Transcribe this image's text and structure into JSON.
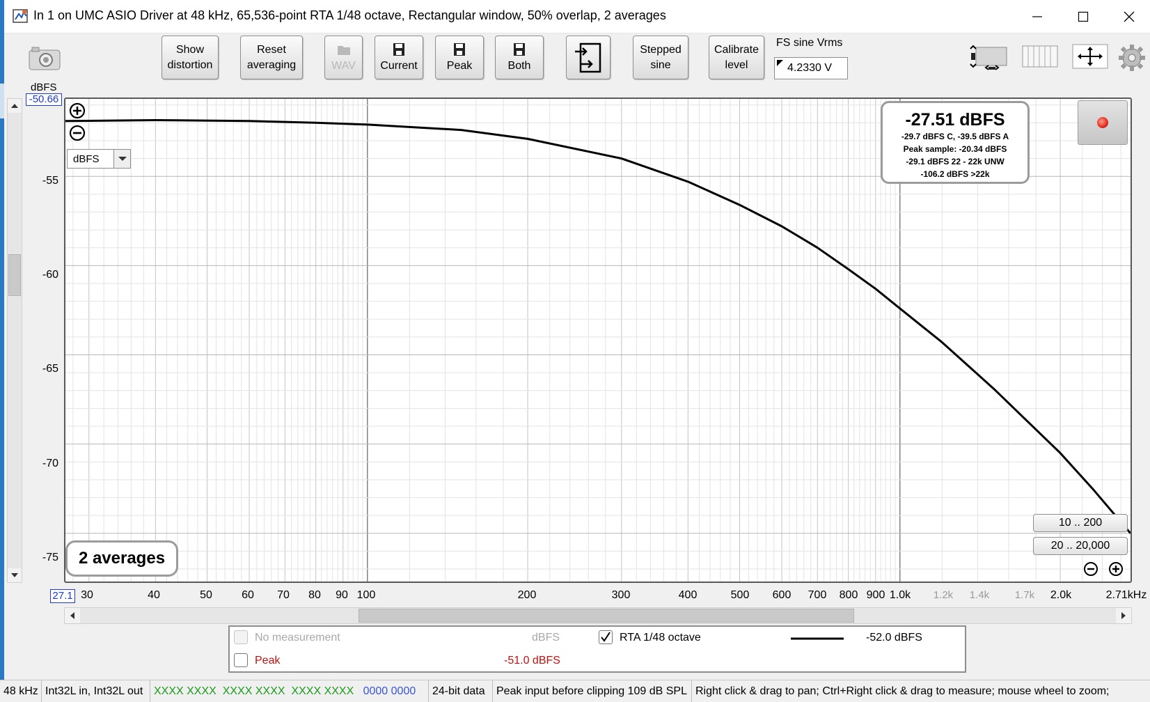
{
  "window": {
    "title": "In 1 on UMC ASIO Driver at 48 kHz, 65,536-point RTA 1/48 octave, Rectangular window, 50% overlap, 2 averages"
  },
  "toolbar": {
    "show_distortion_l1": "Show",
    "show_distortion_l2": "distortion",
    "reset_averaging_l1": "Reset",
    "reset_averaging_l2": "averaging",
    "wav_label": "WAV",
    "current_label": "Current",
    "peak_label": "Peak",
    "both_label": "Both",
    "stepped_sine_l1": "Stepped",
    "stepped_sine_l2": "sine",
    "calibrate_l1": "Calibrate",
    "calibrate_l2": "level",
    "fs_label": "FS sine Vrms",
    "fs_value": "4.2330 V"
  },
  "y_axis": {
    "unit": "dBFS",
    "top_value": "-50.66",
    "ticks": [
      "-55",
      "-60",
      "-65",
      "-70",
      "-75"
    ]
  },
  "x_axis": {
    "left_value": "27.1",
    "ticks": [
      "30",
      "40",
      "50",
      "60",
      "70",
      "80",
      "90",
      "100",
      "200",
      "300",
      "400",
      "500",
      "600",
      "700",
      "800",
      "900",
      "1.0k",
      "2.0k",
      "2.71kHz"
    ],
    "minor_ticks": [
      "1.2k",
      "1.4k",
      "1.7k"
    ]
  },
  "plot": {
    "unit_select": "dBFS",
    "level_main": "-27.51 dBFS",
    "level_line1": "-29.7 dBFS C, -39.5 dBFS A",
    "level_line2": "Peak sample: -20.34 dBFS",
    "level_line3": "-29.1 dBFS 22 - 22k UNW",
    "level_line4": "-106.2 dBFS >22k",
    "averages": "2 averages",
    "range_a": "10 .. 200",
    "range_b": "20 .. 20,000"
  },
  "legend": {
    "row1_label": "No measurement",
    "row1_unit": "dBFS",
    "row2_label": "Peak",
    "row2_value": "-51.0 dBFS",
    "rta_label": "RTA 1/48 octave",
    "rta_value": "-52.0 dBFS",
    "rta_checked": true
  },
  "status": {
    "rate": "48 kHz",
    "io": "Int32L in, Int32L out",
    "meter_green_1": "XXXX XXXX",
    "meter_green_2": "XXXX XXXX",
    "meter_green_3": "XXXX XXXX",
    "meter_blue": "0000 0000",
    "bits": "24-bit data",
    "peak_input": "Peak input before clipping 109 dB SPL",
    "hint": "Right click & drag to pan; Ctrl+Right click & drag to measure; mouse wheel to zoom;"
  },
  "colors": {
    "accent_blue": "#1d3ad6",
    "peak_red": "#c2100c",
    "meter_green": "#1a9a1a"
  },
  "chart_data": {
    "type": "line",
    "xscale": "log",
    "xlim": [
      27.1,
      2710
    ],
    "ylim": [
      -77.7,
      -50.66
    ],
    "series": [
      {
        "name": "RTA 1/48 octave",
        "x": [
          27.1,
          40,
          60,
          80,
          100,
          150,
          200,
          300,
          400,
          500,
          600,
          700,
          800,
          900,
          1000,
          1200,
          1500,
          2000,
          2300,
          2710
        ],
        "y": [
          -51.9,
          -51.85,
          -51.9,
          -52.0,
          -52.1,
          -52.4,
          -52.9,
          -54.0,
          -55.3,
          -56.6,
          -57.8,
          -59.0,
          -60.2,
          -61.3,
          -62.4,
          -64.3,
          -66.9,
          -70.5,
          -72.5,
          -75.0
        ]
      }
    ]
  }
}
